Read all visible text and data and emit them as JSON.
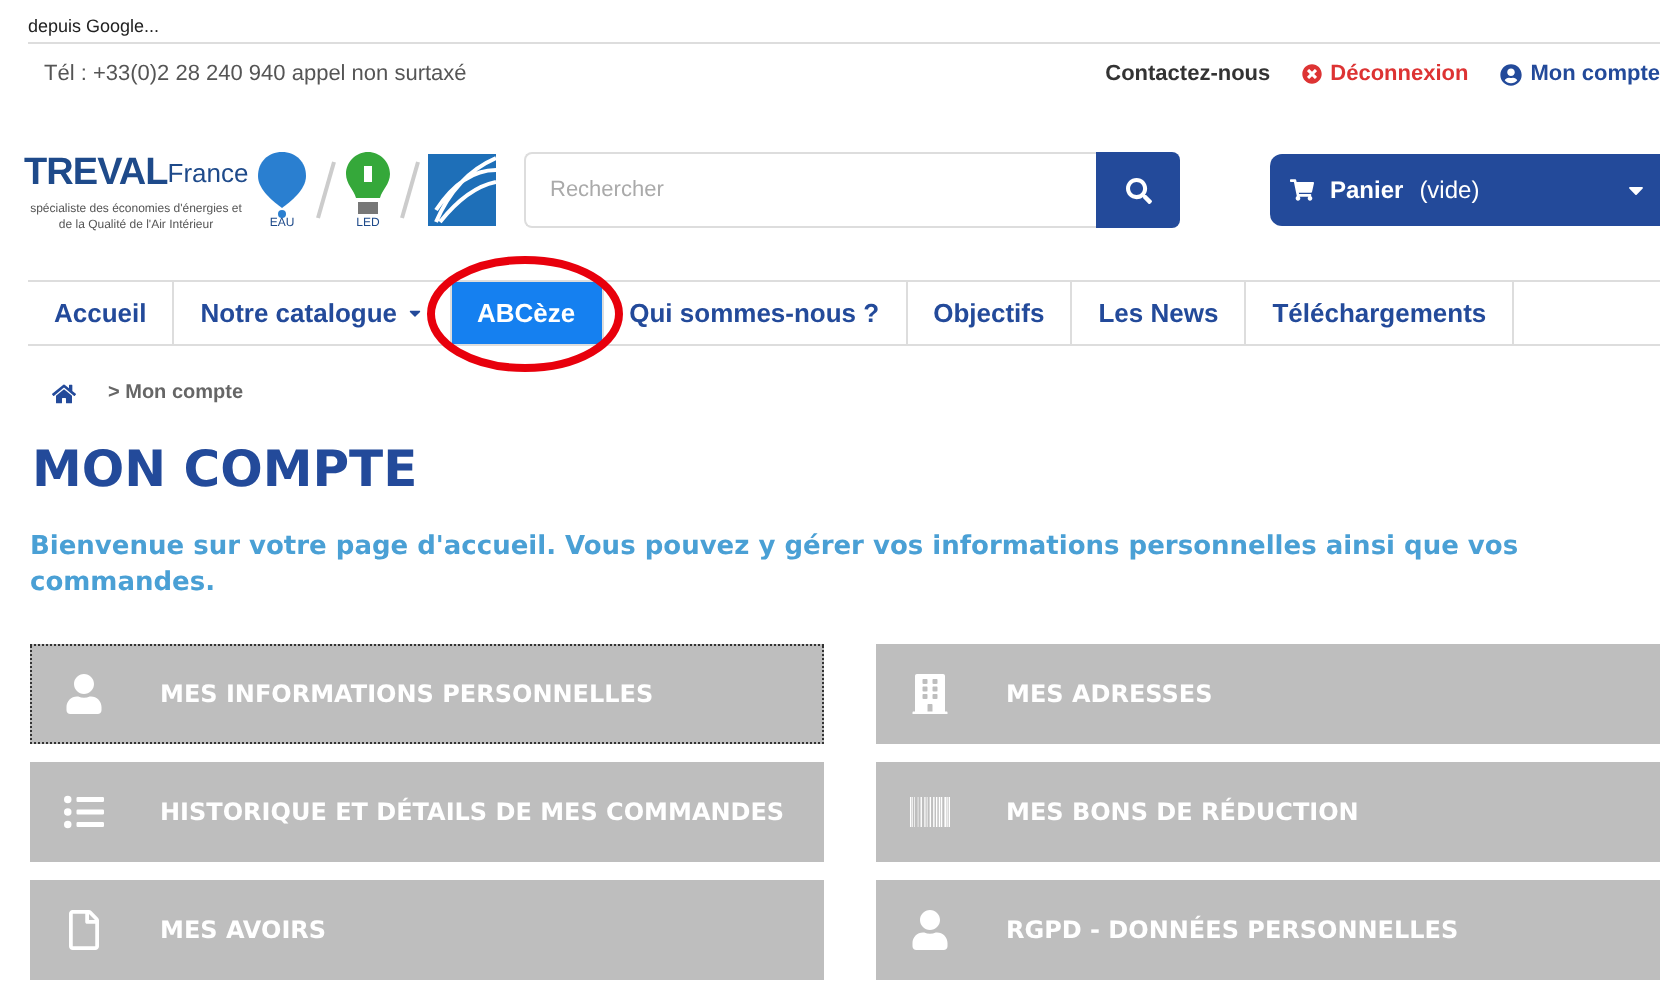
{
  "top_strip": {
    "text": "depuis Google..."
  },
  "topbar": {
    "phone": "Tél : +33(0)2 28 240 940 appel non surtaxé",
    "links": [
      {
        "kind": "plain",
        "label": "Contactez-nous"
      },
      {
        "kind": "logout",
        "label": "Déconnexion"
      },
      {
        "kind": "account",
        "label": "Mon compte"
      }
    ]
  },
  "logo": {
    "brand": "TREVAL",
    "brand_suffix": "France",
    "tagline": "spécialiste des économies d'énergies et de la Qualité de l'Air Intérieur",
    "badges": [
      {
        "kind": "balloon",
        "label": "EAU"
      },
      {
        "kind": "bulb",
        "label": "LED"
      },
      {
        "kind": "lines"
      }
    ]
  },
  "search": {
    "placeholder": "Rechercher"
  },
  "cart": {
    "label": "Panier",
    "status": "(vide)"
  },
  "nav": [
    {
      "label": "Accueil",
      "selected": false,
      "dropdown": false
    },
    {
      "label": "Notre catalogue",
      "selected": false,
      "dropdown": true
    },
    {
      "label": "ABCèze",
      "selected": true,
      "dropdown": false
    },
    {
      "label": "Qui sommes-nous ?",
      "selected": false,
      "dropdown": false
    },
    {
      "label": "Objectifs",
      "selected": false,
      "dropdown": false
    },
    {
      "label": "Les News",
      "selected": false,
      "dropdown": false
    },
    {
      "label": "Téléchargements",
      "selected": false,
      "dropdown": false
    }
  ],
  "breadcrumb": {
    "current": "> Mon compte"
  },
  "title": "MON COMPTE",
  "welcome": "Bienvenue sur votre page d'accueil. Vous pouvez y gérer vos informations personnelles ainsi que vos commandes.",
  "tiles": [
    {
      "kind": "user",
      "label": "MES INFORMATIONS PERSONNELLES",
      "selected": true
    },
    {
      "kind": "building",
      "label": "MES ADRESSES",
      "selected": false
    },
    {
      "kind": "list",
      "label": "HISTORIQUE ET DÉTAILS DE MES COMMANDES",
      "selected": false
    },
    {
      "kind": "barcode",
      "label": "MES BONS DE RÉDUCTION",
      "selected": false
    },
    {
      "kind": "file",
      "label": "MES AVOIRS",
      "selected": false
    },
    {
      "kind": "user",
      "label": "RGPD - DONNÉES PERSONNELLES",
      "selected": false
    }
  ]
}
